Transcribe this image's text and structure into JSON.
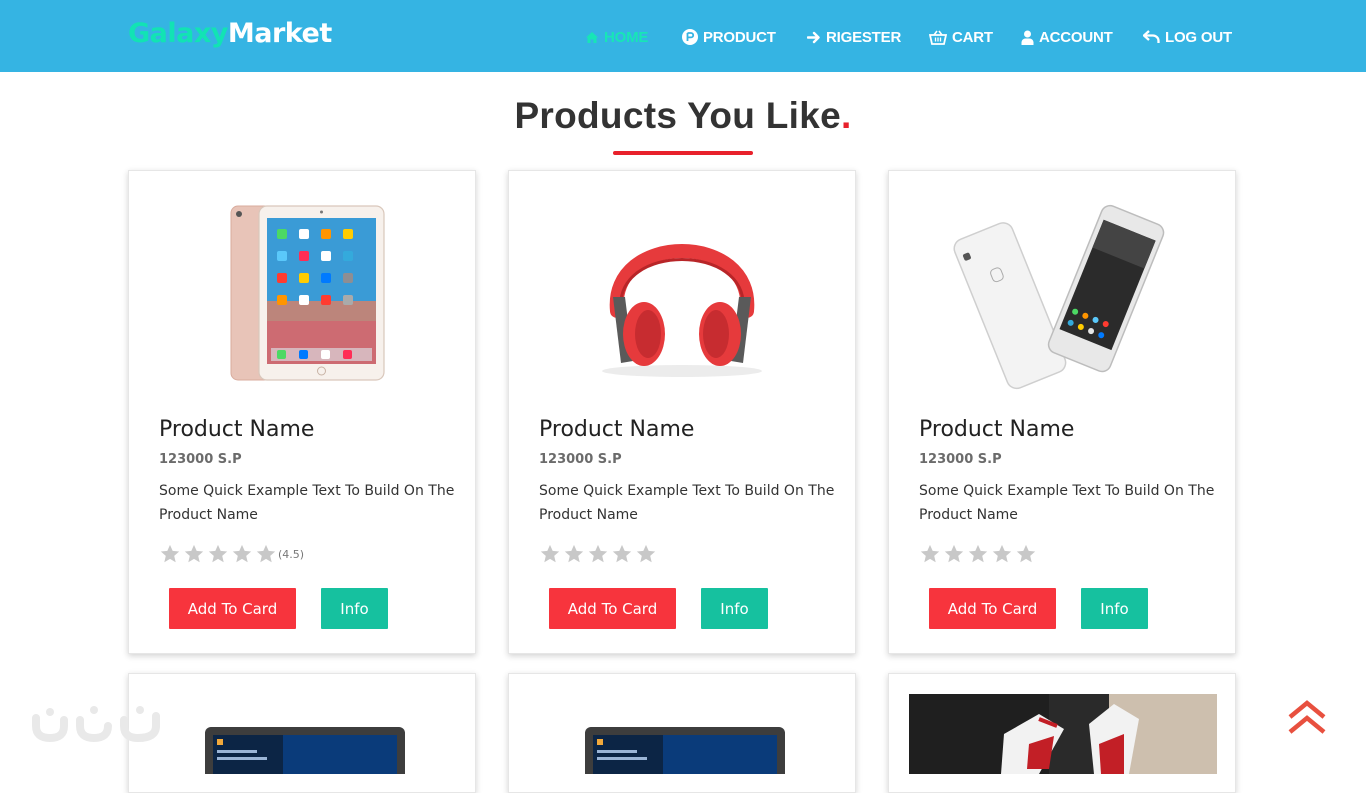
{
  "brand": {
    "part1": "Galaxy",
    "part2": "Market"
  },
  "nav": {
    "home": "HOME",
    "product": "PRODUCT",
    "register": "RIGESTER",
    "cart": "CART",
    "account": "ACCOUNT",
    "logout": "LOG OUT"
  },
  "colors": {
    "nav_bg": "#35b4e3",
    "accent_green": "#16c19f",
    "accent_red": "#f7343d"
  },
  "page": {
    "title": "Products You Like",
    "title_dot": "."
  },
  "products": [
    {
      "name": "Product Name",
      "price": "123000 S.P",
      "description": "Some Quick Example Text To Build On The Product Name",
      "rating_label": "(4.5)",
      "add_label": "Add To Card",
      "info_label": "Info",
      "image": "ipad-icon"
    },
    {
      "name": "Product Name",
      "price": "123000 S.P",
      "description": "Some Quick Example Text To Build On The Product Name",
      "rating_label": "",
      "add_label": "Add To Card",
      "info_label": "Info",
      "image": "headphones-icon"
    },
    {
      "name": "Product Name",
      "price": "123000 S.P",
      "description": "Some Quick Example Text To Build On The Product Name",
      "rating_label": "",
      "add_label": "Add To Card",
      "info_label": "Info",
      "image": "smartphone-icon"
    }
  ],
  "next_row_images": [
    "laptop-icon",
    "laptop-icon",
    "sneaker-photo"
  ],
  "watermark_text": "نفذ"
}
